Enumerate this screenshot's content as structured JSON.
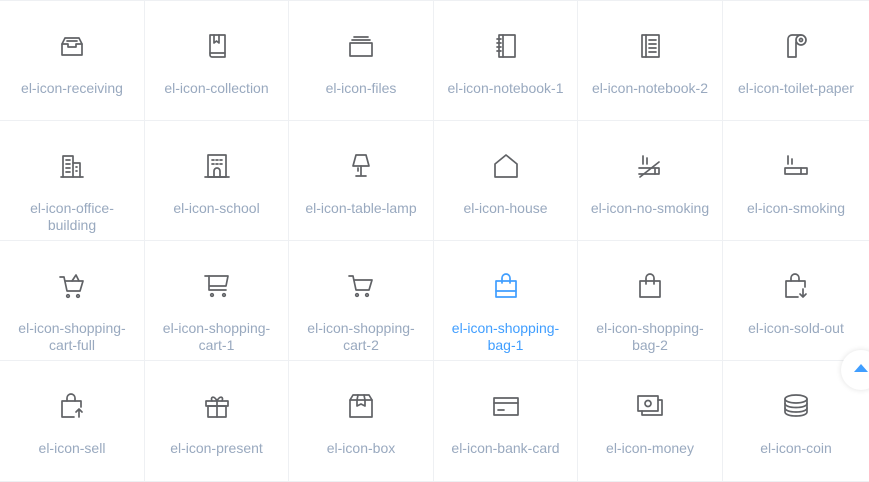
{
  "accent_color": "#409eff",
  "label_color": "#99a9bf",
  "icon_color": "#606266",
  "icons": [
    {
      "label": "el-icon-receiving",
      "icon": "receiving-icon"
    },
    {
      "label": "el-icon-collection",
      "icon": "collection-icon"
    },
    {
      "label": "el-icon-files",
      "icon": "files-icon"
    },
    {
      "label": "el-icon-notebook-1",
      "icon": "notebook-1-icon"
    },
    {
      "label": "el-icon-notebook-2",
      "icon": "notebook-2-icon"
    },
    {
      "label": "el-icon-toilet-paper",
      "icon": "toilet-paper-icon"
    },
    {
      "label": "el-icon-office-building",
      "icon": "office-building-icon"
    },
    {
      "label": "el-icon-school",
      "icon": "school-icon"
    },
    {
      "label": "el-icon-table-lamp",
      "icon": "table-lamp-icon"
    },
    {
      "label": "el-icon-house",
      "icon": "house-icon"
    },
    {
      "label": "el-icon-no-smoking",
      "icon": "no-smoking-icon"
    },
    {
      "label": "el-icon-smoking",
      "icon": "smoking-icon"
    },
    {
      "label": "el-icon-shopping-cart-full",
      "icon": "shopping-cart-full-icon"
    },
    {
      "label": "el-icon-shopping-cart-1",
      "icon": "shopping-cart-1-icon"
    },
    {
      "label": "el-icon-shopping-cart-2",
      "icon": "shopping-cart-2-icon"
    },
    {
      "label": "el-icon-shopping-bag-1",
      "icon": "shopping-bag-1-icon",
      "active": true
    },
    {
      "label": "el-icon-shopping-bag-2",
      "icon": "shopping-bag-2-icon"
    },
    {
      "label": "el-icon-sold-out",
      "icon": "sold-out-icon"
    },
    {
      "label": "el-icon-sell",
      "icon": "sell-icon"
    },
    {
      "label": "el-icon-present",
      "icon": "present-icon"
    },
    {
      "label": "el-icon-box",
      "icon": "box-icon"
    },
    {
      "label": "el-icon-bank-card",
      "icon": "bank-card-icon"
    },
    {
      "label": "el-icon-money",
      "icon": "money-icon"
    },
    {
      "label": "el-icon-coin",
      "icon": "coin-icon"
    }
  ],
  "back_to_top": {
    "icon": "caret-top-icon"
  }
}
